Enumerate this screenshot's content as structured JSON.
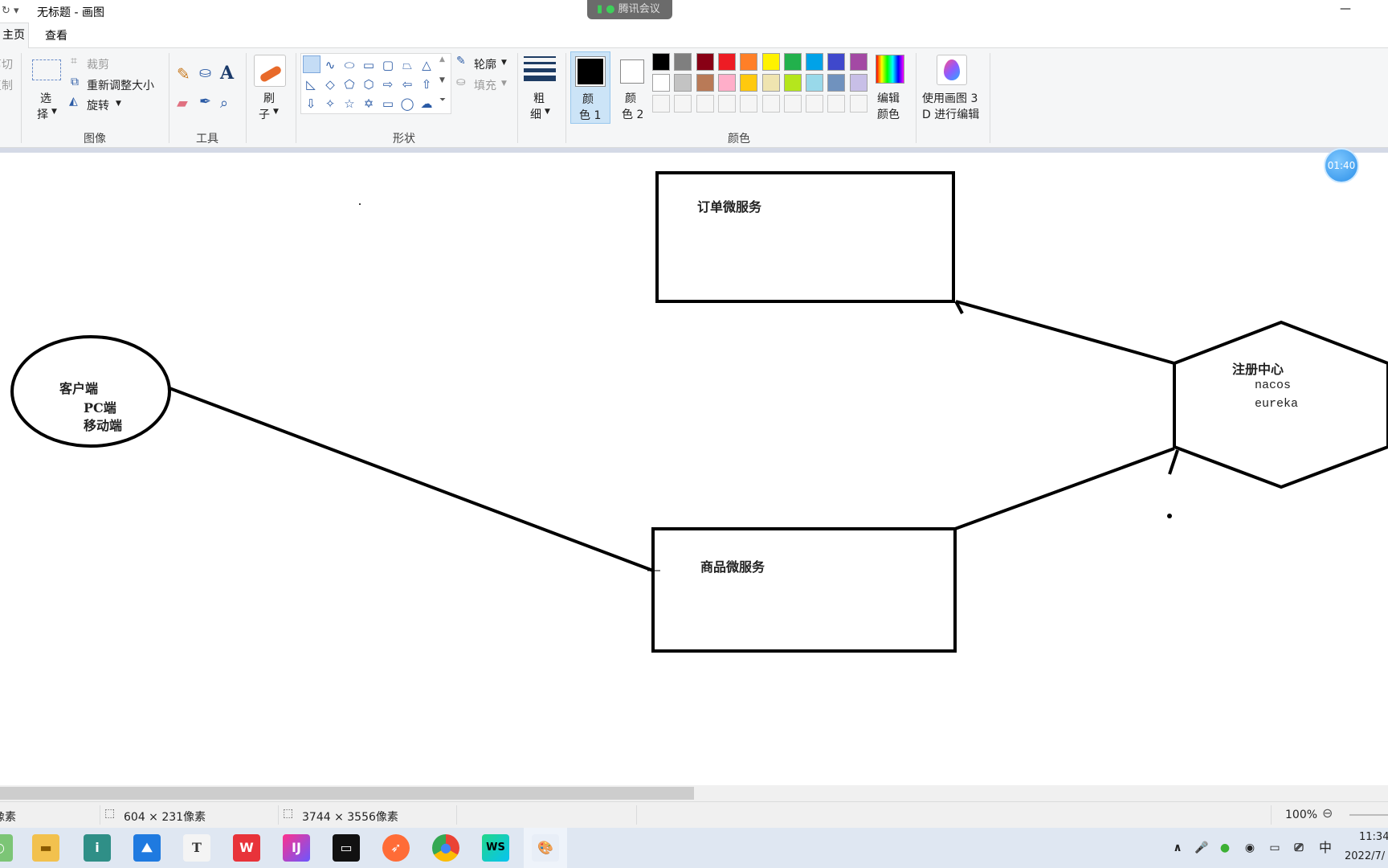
{
  "window": {
    "title": "无标题 - 画图",
    "meeting_badge": "腾讯会议",
    "minimize": "—"
  },
  "tabs": [
    "主页",
    "查看"
  ],
  "ribbon": {
    "clipboard": {
      "cut": "剪切",
      "copy": "复制"
    },
    "image": {
      "select_line1": "选",
      "select_line2": "择",
      "crop": "裁剪",
      "resize": "重新调整大小",
      "rotate": "旋转",
      "group": "图像"
    },
    "tools": {
      "group": "工具",
      "text_tool": "A"
    },
    "brushes": {
      "line1": "刷",
      "line2": "子"
    },
    "shapes": {
      "group": "形状",
      "outline": "轮廓",
      "fill": "填充"
    },
    "size": {
      "line1": "粗",
      "line2": "细"
    },
    "color1": {
      "line1": "颜",
      "line2": "色 1"
    },
    "color2": {
      "line1": "颜",
      "line2": "色 2"
    },
    "colors": {
      "group": "颜色",
      "row1": [
        "#000000",
        "#7f7f7f",
        "#880015",
        "#ed1c24",
        "#ff7f27",
        "#fff200",
        "#22b14c",
        "#00a2e8",
        "#3f48cc",
        "#a349a4"
      ],
      "row2": [
        "#ffffff",
        "#c3c3c3",
        "#b97a57",
        "#ffaec9",
        "#ffc90e",
        "#efe4b0",
        "#b5e61d",
        "#99d9ea",
        "#7092be",
        "#c8bfe7"
      ],
      "row3": [
        "#f5f5f5",
        "#f5f5f5",
        "#f5f5f5",
        "#f5f5f5",
        "#f5f5f5",
        "#f5f5f5",
        "#f5f5f5",
        "#f5f5f5",
        "#f5f5f5",
        "#f5f5f5"
      ]
    },
    "edit_colors": {
      "line1": "编辑",
      "line2": "颜色"
    },
    "paint3d": {
      "line1": "使用画图 3",
      "line2": "D 进行编辑"
    }
  },
  "timer": "01:40",
  "canvas": {
    "order_service": "订单微服务",
    "product_service": "商品微服务",
    "client": {
      "line1": "客户端",
      "line2": "PC端",
      "line3": "移动端"
    },
    "registry": {
      "line1": "注册中心",
      "line2": "nacos",
      "line3": "eureka"
    }
  },
  "status": {
    "position": "像素",
    "selection_size": "604 × 231像素",
    "canvas_size": "3744 × 3556像素",
    "zoom": "100%"
  },
  "taskbar": {
    "time": "11:34",
    "date": "2022/7/",
    "ime": "中",
    "apps": [
      "file-explorer",
      "intellij-idea",
      "lanxin",
      "typora",
      "wps",
      "jetbrains",
      "terminal",
      "postman",
      "chrome",
      "webstorm",
      "paint"
    ]
  }
}
